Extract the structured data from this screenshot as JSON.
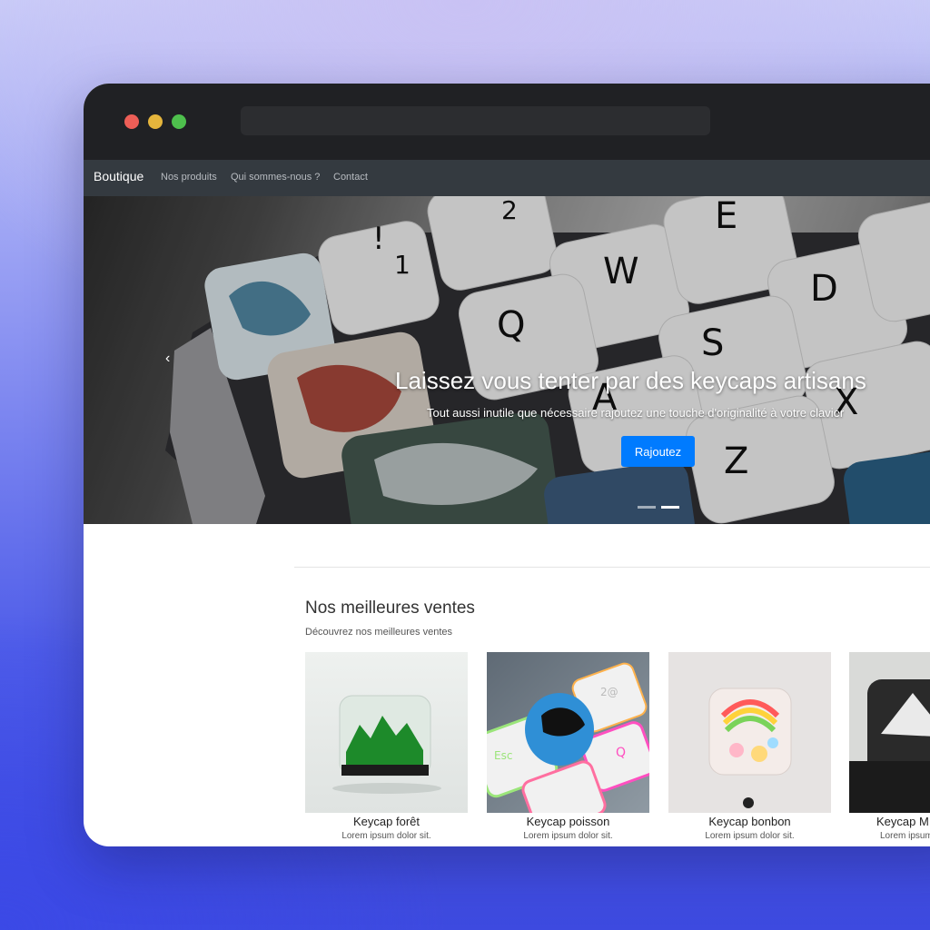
{
  "window": {
    "address_value": ""
  },
  "navbar": {
    "brand": "Boutique",
    "links": [
      {
        "label": "Nos produits"
      },
      {
        "label": "Qui sommes-nous ?"
      },
      {
        "label": "Contact"
      }
    ]
  },
  "hero": {
    "title": "Laissez vous tenter par des keycaps artisans",
    "subtitle": "Tout aussi inutile que nécessaire rajoutez une touche d'originalité à votre clavier",
    "button_label": "Rajoutez",
    "prev_icon": "chevron-left-icon",
    "slide_count": 2,
    "active_slide": 2,
    "keycap_legends": [
      "!",
      "1",
      "2",
      "Q",
      "W",
      "E",
      "S",
      "D",
      "A",
      "X",
      "Z"
    ]
  },
  "bestsellers": {
    "title": "Nos meilleures ventes",
    "subtitle": "Découvrez nos meilleures ventes",
    "products": [
      {
        "name": "Keycap forêt",
        "description": "Lorem ipsum dolor sit."
      },
      {
        "name": "Keycap poisson",
        "description": "Lorem ipsum dolor sit."
      },
      {
        "name": "Keycap bonbon",
        "description": "Lorem ipsum dolor sit."
      },
      {
        "name": "Keycap M",
        "description": "Lorem ipsum"
      }
    ],
    "poisson_key_legends": [
      "Esc",
      "2@",
      "Q"
    ]
  },
  "colors": {
    "accent": "#007bff",
    "navbar": "#343a40",
    "titlebar": "#202124",
    "dot_red": "#ed5e57",
    "dot_yellow": "#e5b53c",
    "dot_green": "#4ec04d"
  }
}
